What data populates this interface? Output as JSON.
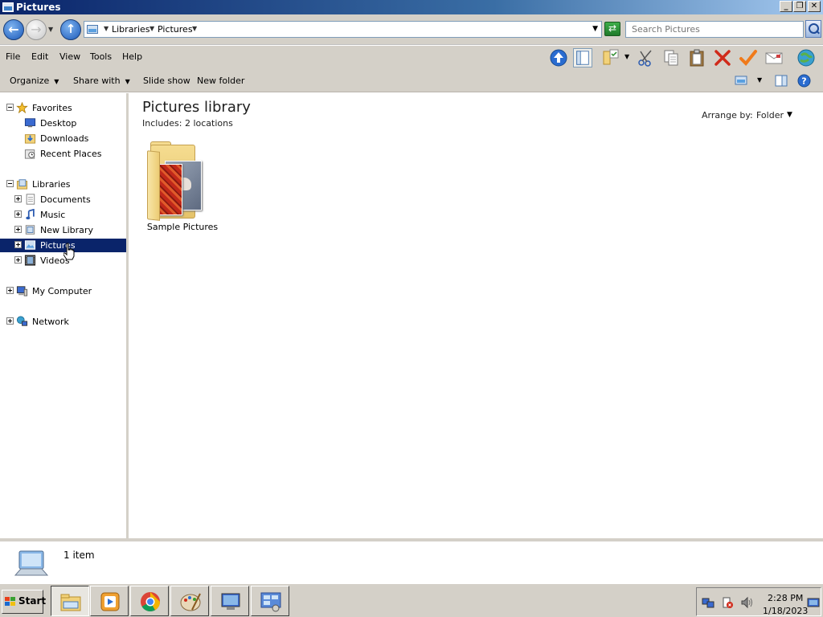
{
  "window": {
    "title": "Pictures"
  },
  "address": {
    "crumbs": [
      "Libraries",
      "Pictures"
    ],
    "search_placeholder": "Search Pictures"
  },
  "menu": [
    "File",
    "Edit",
    "View",
    "Tools",
    "Help"
  ],
  "commands": {
    "organize": "Organize",
    "share_with": "Share with",
    "slide_show": "Slide show",
    "new_folder": "New folder"
  },
  "nav": {
    "favorites": {
      "label": "Favorites",
      "items": [
        "Desktop",
        "Downloads",
        "Recent Places"
      ]
    },
    "libraries": {
      "label": "Libraries",
      "items": [
        "Documents",
        "Music",
        "New Library",
        "Pictures",
        "Videos"
      ],
      "selected": "Pictures"
    },
    "computer": "My Computer",
    "network": "Network"
  },
  "content": {
    "title": "Pictures library",
    "includes": "Includes:  2 locations",
    "arrange_label": "Arrange by:",
    "arrange_value": "Folder",
    "items": [
      {
        "name": "Sample Pictures"
      }
    ]
  },
  "details": {
    "count": "1 item"
  },
  "taskbar": {
    "start": "Start",
    "time": "2:28 PM",
    "date": "1/18/2023"
  },
  "colors": {
    "selection": "#0a246a",
    "chrome": "#d4d0c8"
  }
}
